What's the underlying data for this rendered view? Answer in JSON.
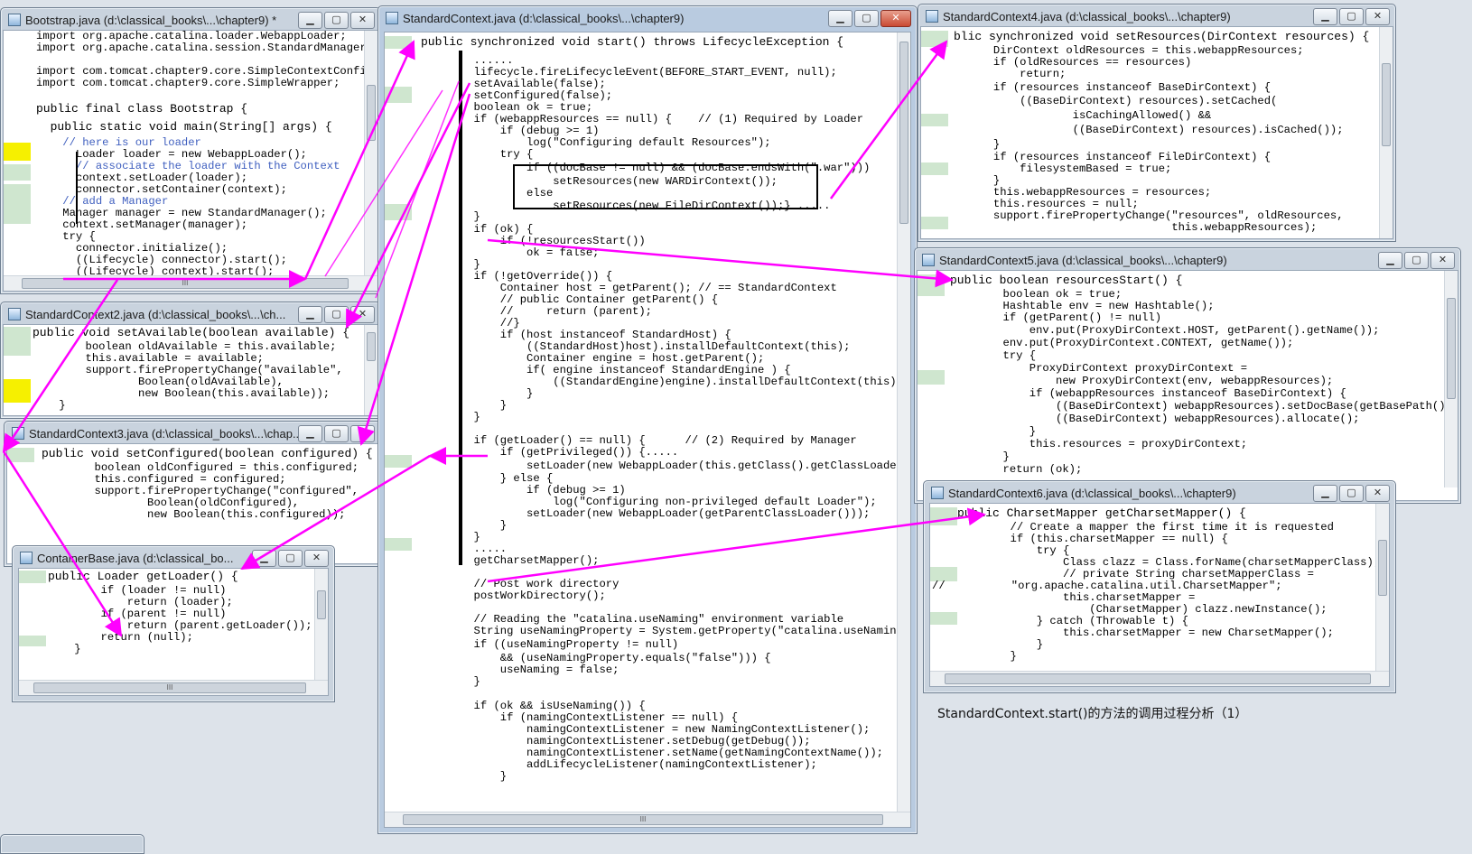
{
  "colors": {
    "arrow": "#ff00ff",
    "gutter_mark": "#cfe6cf",
    "highlight": "#f6f000",
    "keyword": "#7f0055"
  },
  "window_buttons": {
    "minimize": "▁",
    "maximize": "▢",
    "close": "✕"
  },
  "caption": "StandardContext.start()的方法的调用过程分析（1）",
  "windows": {
    "bootstrap": {
      "title": "Bootstrap.java (d:\\classical_books\\...\\chapter9) *",
      "lines": [
        "import org.apache.catalina.loader.WebappLoader;",
        "import org.apache.catalina.session.StandardManager;",
        "",
        "import com.tomcat.chapter9.core.SimpleContextConfig;",
        "import com.tomcat.chapter9.core.SimpleWrapper;",
        "",
        "public final class Bootstrap {",
        "  public static void main(String[] args) {",
        "    // here is our loader",
        "      Loader loader = new WebappLoader();",
        "      // associate the loader with the Context",
        "      context.setLoader(loader);",
        "      connector.setContainer(context);",
        "    // add a Manager",
        "    Manager manager = new StandardManager();",
        "    context.setManager(manager);",
        "    try {",
        "      connector.initialize();",
        "      ((Lifecycle) connector).start();",
        "      ((Lifecycle) context).start();"
      ],
      "hscroll": "III"
    },
    "sc2": {
      "title": "StandardContext2.java (d:\\classical_books\\...\\ch...",
      "lines": [
        "public void setAvailable(boolean available) {",
        "        boolean oldAvailable = this.available;",
        "        this.available = available;",
        "        support.firePropertyChange(\"available\",",
        "                Boolean(oldAvailable),",
        "                new Boolean(this.available));",
        "    }"
      ]
    },
    "sc3": {
      "title": "StandardContext3.java (d:\\classical_books\\...\\chap...",
      "lines": [
        "public void setConfigured(boolean configured) {",
        "        boolean oldConfigured = this.configured;",
        "        this.configured = configured;",
        "        support.firePropertyChange(\"configured\",",
        "                Boolean(oldConfigured),",
        "                new Boolean(this.configured));"
      ]
    },
    "containerbase": {
      "title": "ContainerBase.java (d:\\classical_bo...",
      "lines": [
        "public Loader getLoader() {",
        "        if (loader != null)",
        "            return (loader);",
        "        if (parent != null)",
        "            return (parent.getLoader());",
        "        return (null);",
        "    }"
      ],
      "hscroll": "III"
    },
    "main": {
      "title": "StandardContext.java (d:\\classical_books\\...\\chapter9)",
      "lines": [
        "public synchronized void start() throws LifecycleException {",
        "",
        "        ......",
        "        lifecycle.fireLifecycleEvent(BEFORE_START_EVENT, null);",
        "        setAvailable(false);",
        "        setConfigured(false);",
        "        boolean ok = true;",
        "        if (webappResources == null) {    // (1) Required by Loader",
        "            if (debug >= 1)",
        "                log(\"Configuring default Resources\");",
        "            try {",
        "                if ((docBase != null) && (docBase.endsWith(\".war\")))",
        "                    setResources(new WARDirContext());",
        "                else",
        "                    setResources(new FileDirContext());} .....",
        "        }",
        "        if (ok) {",
        "            if (!resourcesStart())",
        "                ok = false;",
        "        }",
        "        if (!getOverride()) {",
        "            Container host = getParent(); // == StandardContext",
        "            // public Container getParent() {",
        "            //     return (parent);",
        "            //}",
        "            if (host instanceof StandardHost) {",
        "                ((StandardHost)host).installDefaultContext(this);",
        "                Container engine = host.getParent();",
        "                if( engine instanceof StandardEngine ) {",
        "                    ((StandardEngine)engine).installDefaultContext(this);",
        "                }",
        "            }",
        "        }",
        "",
        "        if (getLoader() == null) {      // (2) Required by Manager",
        "            if (getPrivileged()) {.....",
        "                setLoader(new WebappLoader(this.getClass().getClassLoader()));",
        "            } else {",
        "                if (debug >= 1)",
        "                    log(\"Configuring non-privileged default Loader\");",
        "                setLoader(new WebappLoader(getParentClassLoader()));",
        "            }",
        "        }",
        "        .....",
        "        getCharsetMapper();",
        "",
        "        // Post work directory",
        "        postWorkDirectory();",
        "",
        "        // Reading the \"catalina.useNaming\" environment variable",
        "        String useNamingProperty = System.getProperty(\"catalina.useNaming\");",
        "        if ((useNamingProperty != null)",
        "            && (useNamingProperty.equals(\"false\"))) {",
        "            useNaming = false;",
        "        }",
        "",
        "        if (ok && isUseNaming()) {",
        "            if (namingContextListener == null) {",
        "                namingContextListener = new NamingContextListener();",
        "                namingContextListener.setDebug(getDebug());",
        "                namingContextListener.setName(getNamingContextName());",
        "                addLifecycleListener(namingContextListener);",
        "            }"
      ],
      "hscroll": "III"
    },
    "sc4": {
      "title": "StandardContext4.java (d:\\classical_books\\...\\chapter9)",
      "lines": [
        "blic synchronized void setResources(DirContext resources) {",
        "      DirContext oldResources = this.webappResources;",
        "      if (oldResources == resources)",
        "          return;",
        "      if (resources instanceof BaseDirContext) {",
        "          ((BaseDirContext) resources).setCached(",
        "                  isCachingAllowed() &&",
        "                  ((BaseDirContext) resources).isCached());",
        "      }",
        "      if (resources instanceof FileDirContext) {",
        "          filesystemBased = true;",
        "      }",
        "      this.webappResources = resources;",
        "      this.resources = null;",
        "      support.firePropertyChange(\"resources\", oldResources,",
        "                                 this.webappResources);"
      ]
    },
    "sc5": {
      "title": "StandardContext5.java (d:\\classical_books\\...\\chapter9)",
      "lines": [
        "public boolean resourcesStart() {",
        "        boolean ok = true;",
        "        Hashtable env = new Hashtable();",
        "        if (getParent() != null)",
        "            env.put(ProxyDirContext.HOST, getParent().getName());",
        "        env.put(ProxyDirContext.CONTEXT, getName());",
        "        try {",
        "            ProxyDirContext proxyDirContext =",
        "                new ProxyDirContext(env, webappResources);",
        "            if (webappResources instanceof BaseDirContext) {",
        "                ((BaseDirContext) webappResources).setDocBase(getBasePath());",
        "                ((BaseDirContext) webappResources).allocate();",
        "            }",
        "            this.resources = proxyDirContext;",
        "        }",
        "        return (ok);"
      ]
    },
    "sc6": {
      "title": "StandardContext6.java (d:\\classical_books\\...\\chapter9)",
      "lines": [
        "public CharsetMapper getCharsetMapper() {",
        "        // Create a mapper the first time it is requested",
        "        if (this.charsetMapper == null) {",
        "            try {",
        "                Class clazz = Class.forName(charsetMapperClass);",
        "                // private String charsetMapperClass =",
        "//          \"org.apache.catalina.util.CharsetMapper\";",
        "                this.charsetMapper =",
        "                    (CharsetMapper) clazz.newInstance();",
        "            } catch (Throwable t) {",
        "                this.charsetMapper = new CharsetMapper();",
        "            }",
        "        }"
      ]
    }
  }
}
